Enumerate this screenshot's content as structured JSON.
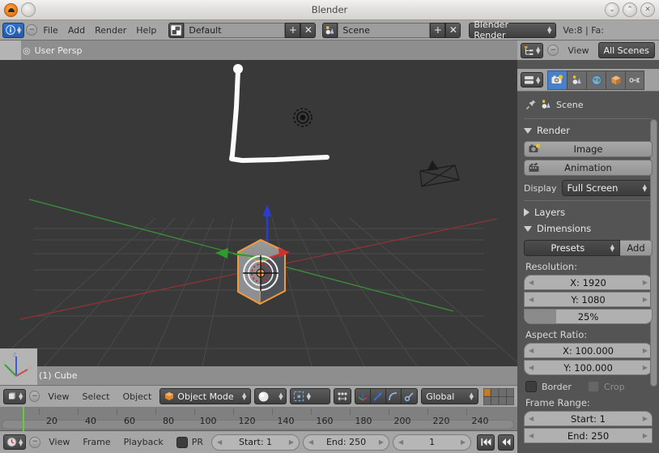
{
  "window": {
    "title": "Blender",
    "logo_icon": "blender-logo-icon",
    "menu_dot_icon": "window-menu-icon",
    "minimize_label": "⌄",
    "maximize_label": "⌃",
    "close_label": "✕"
  },
  "topheader": {
    "editor_type_icon": "info-editor-icon",
    "collapse_icon": "collapse-menus-icon",
    "menus": [
      "File",
      "Add",
      "Render",
      "Help"
    ],
    "screen_layout": {
      "icon": "screen-layout-icon",
      "value": "Default",
      "add_label": "+",
      "delete_label": "✕"
    },
    "scene": {
      "icon": "scene-data-icon",
      "value": "Scene",
      "add_label": "+",
      "delete_label": "✕"
    },
    "render_engine": {
      "value": "Blender Render",
      "chevron": "updown-arrows-icon"
    },
    "status": "Ve:8 | Fa:"
  },
  "viewport": {
    "corner_widget_icon": "viewport-corner-widget",
    "plus_icon": "toolshelf-toggle-icon",
    "view_label": "User Persp",
    "object_label": "(1) Cube",
    "axis_gizmo_icon": "axis-gizmo-icon",
    "scene_objects": {
      "cube": "cube-object",
      "lamp": "lamp-object",
      "camera": "camera-object",
      "annotation": "grease-pencil-stroke",
      "cursor": "3d-cursor",
      "manipulator": "transform-manipulator"
    }
  },
  "viewport_toolbar": {
    "editor_type_icon": "view3d-editor-icon",
    "collapse_icon": "collapse-menus-icon",
    "menus": [
      "View",
      "Select",
      "Object"
    ],
    "mode": {
      "icon": "object-mode-icon",
      "value": "Object Mode",
      "chevron": "updown-arrows-icon"
    },
    "shading": {
      "icon": "solid-shading-icon",
      "chevron": "updown-arrows-icon"
    },
    "pivot": {
      "icon": "pivot-median-icon",
      "chevron": "updown-arrows-icon",
      "snap_icon": "proportional-edit-icon"
    },
    "manipulators": {
      "translate_icon": "manipulator-translate-icon",
      "rotate_icon": "manipulator-rotate-icon",
      "scale_icon": "manipulator-scale-icon",
      "extra_icon": "manipulator-extra-icon"
    },
    "orientation": {
      "value": "Global",
      "chevron": "updown-arrows-icon"
    },
    "layers_icon": "scene-layers-grid"
  },
  "timeline": {
    "editor_type_icon": "timeline-editor-icon",
    "collapse_icon": "collapse-menus-icon",
    "menus": [
      "View",
      "Frame",
      "Playback"
    ],
    "preview_range": {
      "checkbox_icon": "preview-range-checkbox",
      "label": "PR"
    },
    "start": {
      "label": "Start: 1"
    },
    "end": {
      "label": "End: 250"
    },
    "current": {
      "label": "1"
    },
    "jump_start_icon": "jump-to-start-icon",
    "rewind_icon": "rewind-icon",
    "ruler": {
      "ticks": [
        20,
        40,
        60,
        80,
        100,
        120,
        140,
        160,
        180,
        200,
        220,
        240
      ],
      "playhead_frame": 1
    }
  },
  "outliner": {
    "editor_type_icon": "outliner-editor-icon",
    "collapse_icon": "collapse-menus-icon",
    "menu": "View",
    "display_mode": "All Scenes"
  },
  "properties": {
    "editor_type_icon": "properties-editor-icon",
    "tabs": [
      {
        "name": "render-tab",
        "icon": "camera-render-icon",
        "active": true
      },
      {
        "name": "scene-tab",
        "icon": "scene-icon",
        "active": false
      },
      {
        "name": "world-tab",
        "icon": "world-globe-icon",
        "active": false
      },
      {
        "name": "object-tab",
        "icon": "object-cube-icon",
        "active": false
      },
      {
        "name": "constraints-tab",
        "icon": "link-chain-icon",
        "active": false
      }
    ],
    "breadcrumb": {
      "pin_icon": "pin-icon",
      "scene_icon": "scene-data-icon",
      "label": "Scene"
    },
    "render_panel": {
      "title": "Render",
      "expanded": true,
      "image_button": {
        "label": "Image",
        "icon": "render-image-icon"
      },
      "animation_button": {
        "label": "Animation",
        "icon": "render-animation-icon"
      },
      "display_label": "Display",
      "display_value": "Full Screen"
    },
    "layers_panel": {
      "title": "Layers",
      "expanded": false
    },
    "dimensions_panel": {
      "title": "Dimensions",
      "expanded": true,
      "presets_value": "Presets",
      "add_label": "Add",
      "resolution_label": "Resolution:",
      "resolution_x": "X: 1920",
      "resolution_y": "Y: 1080",
      "resolution_percent": "25%",
      "resolution_percent_value": 25,
      "aspect_label": "Aspect Ratio:",
      "aspect_x": "X: 100.000",
      "aspect_y": "Y: 100.000",
      "border_label": "Border",
      "crop_label": "Crop",
      "frame_range_label": "Frame Range:",
      "frame_start": "Start: 1",
      "frame_end": "End: 250"
    }
  },
  "colors": {
    "accent_blue": "#4a7fc9",
    "selection_orange": "#f09a3c",
    "axis_x": "#a33b3b",
    "axis_y": "#3b9c3b",
    "manipulator_z": "#2b3bd6",
    "playhead_green": "#5dd130",
    "header_gray": "#a6a6a6",
    "viewport_bg": "#393939",
    "panel_bg": "#545454"
  }
}
